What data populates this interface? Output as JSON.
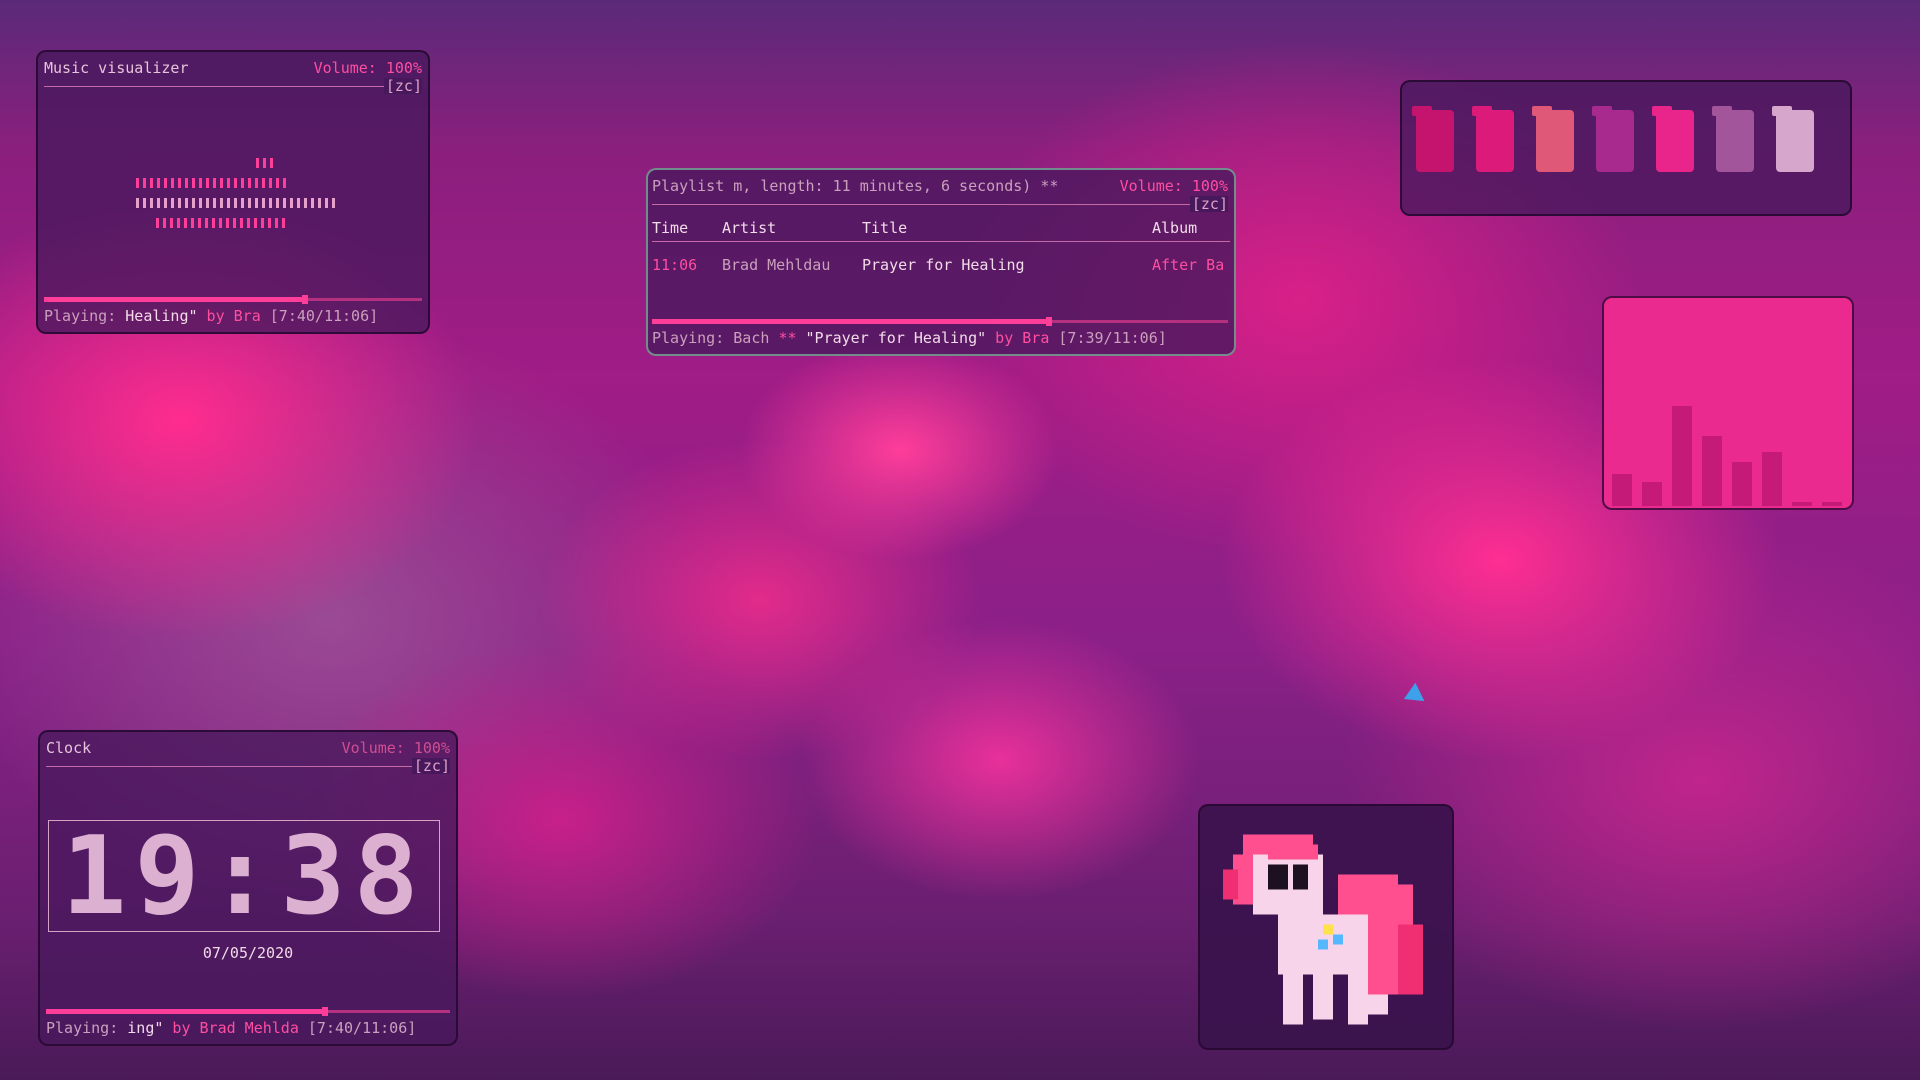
{
  "visualizer": {
    "title": "Music visualizer",
    "volume": "Volume: 100%",
    "tag": "[zc]",
    "status_label": "Playing: ",
    "status_track": " Healing\"",
    "status_by": " by ",
    "status_artist": "Bra",
    "status_time": " [7:40/11:06]",
    "progress": 0.69
  },
  "playlist": {
    "title": "Playlist m, length: 11 minutes, 6 seconds) ** ",
    "volume": "Volume: 100%",
    "tag": "[zc]",
    "columns": [
      "Time",
      "Artist",
      "Title",
      "Album"
    ],
    "rows": [
      {
        "time": "11:06",
        "artist": "Brad Mehldau",
        "title": "Prayer for Healing",
        "album": "After Ba"
      }
    ],
    "status_label": "Playing: ",
    "status_album": "Bach ",
    "status_stars": " ** ",
    "status_track": "\"Prayer for Healing\"",
    "status_by": " by ",
    "status_artist": "Bra",
    "status_time": " [7:39/11:06]",
    "progress": 0.69
  },
  "palette": {
    "colors": [
      "#c4146e",
      "#dc1a7a",
      "#e05878",
      "#a82a8e",
      "#e9248a",
      "#a2559a",
      "#d6a6cc"
    ]
  },
  "bars": {
    "values": [
      0.16,
      0.12,
      0.5,
      0.35,
      0.22,
      0.27,
      0.02,
      0.02
    ],
    "colors": {
      "panel": "#ea2a8e",
      "bar": "#c51a78"
    }
  },
  "clock": {
    "title": "Clock",
    "volume": "Volume: 100%",
    "tag": "[zc]",
    "time": "19:38",
    "date": "07/05/2020",
    "status_label": "Playing: ",
    "status_track": "ing\"",
    "status_by": " by ",
    "status_artist": "Brad Mehlda",
    "status_time": " [7:40/11:06]",
    "progress": 0.69
  },
  "theme": {
    "accent": "#ff3e99",
    "text_light": "#f2dbe9",
    "text_muted": "#caa0bd"
  }
}
